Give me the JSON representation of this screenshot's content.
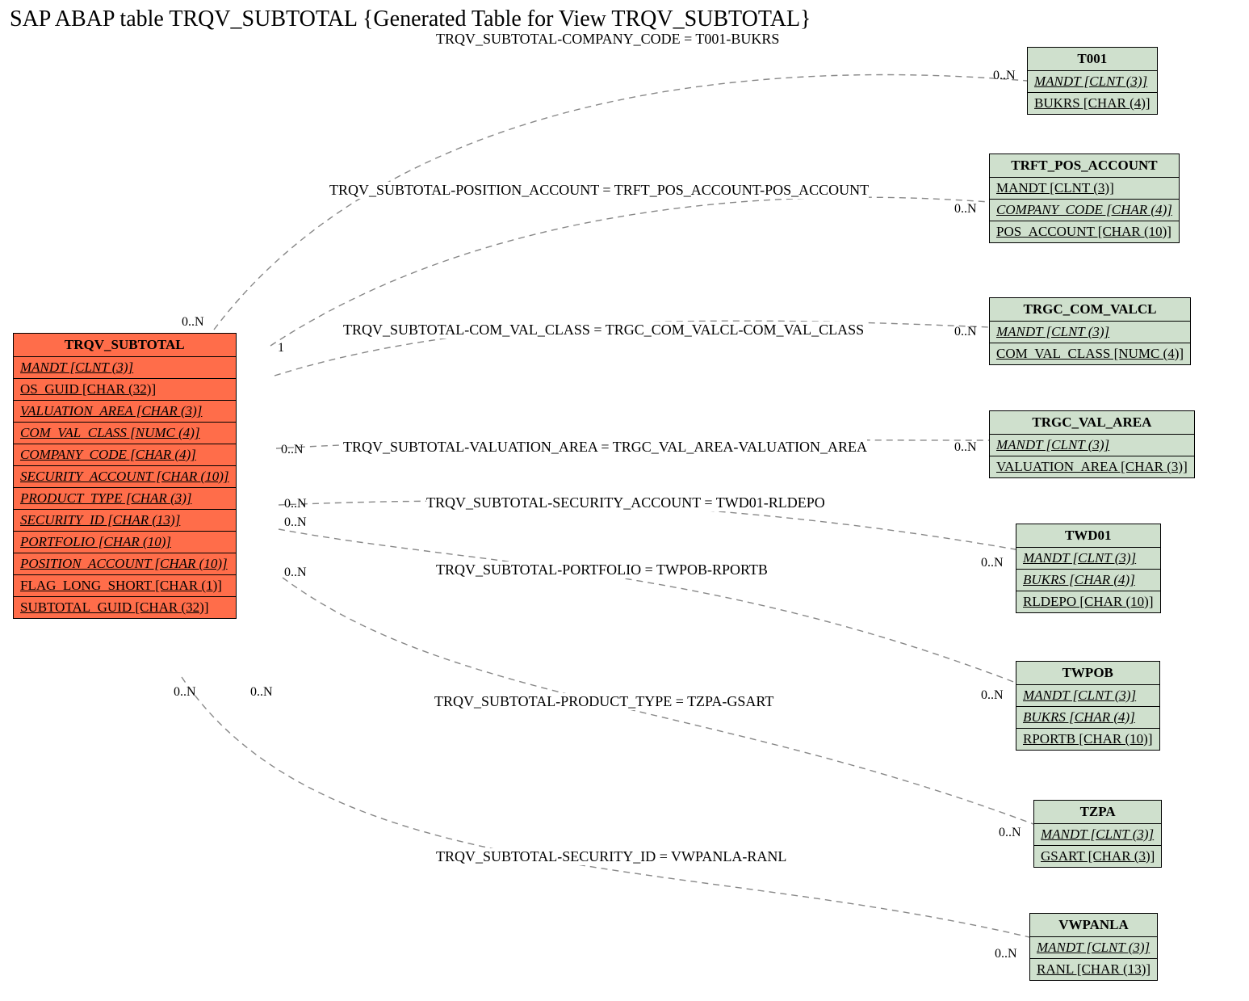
{
  "title": "SAP ABAP table TRQV_SUBTOTAL {Generated Table for View TRQV_SUBTOTAL}",
  "main": {
    "name": "TRQV_SUBTOTAL",
    "fields": [
      {
        "text": "MANDT [CLNT (3)]",
        "fk": true
      },
      {
        "text": "OS_GUID [CHAR (32)]",
        "fk": false
      },
      {
        "text": "VALUATION_AREA [CHAR (3)]",
        "fk": true
      },
      {
        "text": "COM_VAL_CLASS [NUMC (4)]",
        "fk": true
      },
      {
        "text": "COMPANY_CODE [CHAR (4)]",
        "fk": true
      },
      {
        "text": "SECURITY_ACCOUNT [CHAR (10)]",
        "fk": true
      },
      {
        "text": "PRODUCT_TYPE [CHAR (3)]",
        "fk": true
      },
      {
        "text": "SECURITY_ID [CHAR (13)]",
        "fk": true
      },
      {
        "text": "PORTFOLIO [CHAR (10)]",
        "fk": true
      },
      {
        "text": "POSITION_ACCOUNT [CHAR (10)]",
        "fk": true
      },
      {
        "text": "FLAG_LONG_SHORT [CHAR (1)]",
        "fk": false
      },
      {
        "text": "SUBTOTAL_GUID [CHAR (32)]",
        "fk": false
      }
    ]
  },
  "rels": [
    {
      "name": "T001",
      "fields": [
        {
          "text": "MANDT [CLNT (3)]",
          "fk": true
        },
        {
          "text": "BUKRS [CHAR (4)]",
          "fk": false
        }
      ]
    },
    {
      "name": "TRFT_POS_ACCOUNT",
      "fields": [
        {
          "text": "MANDT [CLNT (3)]",
          "fk": false
        },
        {
          "text": "COMPANY_CODE [CHAR (4)]",
          "fk": true
        },
        {
          "text": "POS_ACCOUNT [CHAR (10)]",
          "fk": false
        }
      ]
    },
    {
      "name": "TRGC_COM_VALCL",
      "fields": [
        {
          "text": "MANDT [CLNT (3)]",
          "fk": true
        },
        {
          "text": "COM_VAL_CLASS [NUMC (4)]",
          "fk": false
        }
      ]
    },
    {
      "name": "TRGC_VAL_AREA",
      "fields": [
        {
          "text": "MANDT [CLNT (3)]",
          "fk": true
        },
        {
          "text": "VALUATION_AREA [CHAR (3)]",
          "fk": false
        }
      ]
    },
    {
      "name": "TWD01",
      "fields": [
        {
          "text": "MANDT [CLNT (3)]",
          "fk": true
        },
        {
          "text": "BUKRS [CHAR (4)]",
          "fk": true
        },
        {
          "text": "RLDEPO [CHAR (10)]",
          "fk": false
        }
      ]
    },
    {
      "name": "TWPOB",
      "fields": [
        {
          "text": "MANDT [CLNT (3)]",
          "fk": true
        },
        {
          "text": "BUKRS [CHAR (4)]",
          "fk": true
        },
        {
          "text": "RPORTB [CHAR (10)]",
          "fk": false
        }
      ]
    },
    {
      "name": "TZPA",
      "fields": [
        {
          "text": "MANDT [CLNT (3)]",
          "fk": true
        },
        {
          "text": "GSART [CHAR (3)]",
          "fk": false
        }
      ]
    },
    {
      "name": "VWPANLA",
      "fields": [
        {
          "text": "MANDT [CLNT (3)]",
          "fk": true
        },
        {
          "text": "RANL [CHAR (13)]",
          "fk": false
        }
      ]
    }
  ],
  "joins": [
    "TRQV_SUBTOTAL-COMPANY_CODE = T001-BUKRS",
    "TRQV_SUBTOTAL-POSITION_ACCOUNT = TRFT_POS_ACCOUNT-POS_ACCOUNT",
    "TRQV_SUBTOTAL-COM_VAL_CLASS = TRGC_COM_VALCL-COM_VAL_CLASS",
    "TRQV_SUBTOTAL-VALUATION_AREA = TRGC_VAL_AREA-VALUATION_AREA",
    "TRQV_SUBTOTAL-SECURITY_ACCOUNT = TWD01-RLDEPO",
    "TRQV_SUBTOTAL-PORTFOLIO = TWPOB-RPORTB",
    "TRQV_SUBTOTAL-PRODUCT_TYPE = TZPA-GSART",
    "TRQV_SUBTOTAL-SECURITY_ID = VWPANLA-RANL"
  ],
  "cards": {
    "zeroN": "0..N",
    "one": "1"
  }
}
